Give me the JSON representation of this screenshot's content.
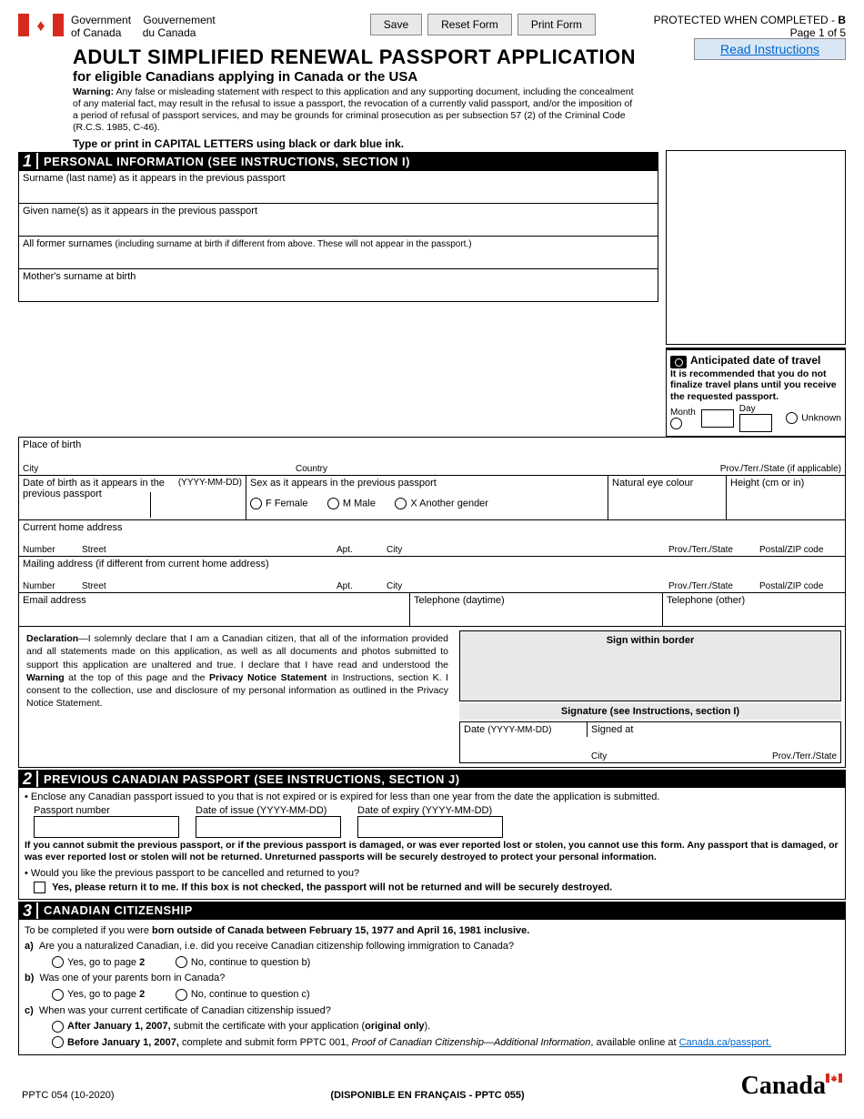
{
  "header": {
    "gov_en": "Government",
    "gov_en2": "of Canada",
    "gov_fr": "Gouvernement",
    "gov_fr2": "du Canada",
    "btn_save": "Save",
    "btn_reset": "Reset Form",
    "btn_print": "Print Form",
    "protected": "PROTECTED WHEN COMPLETED - ",
    "protected_b": "B",
    "page": "Page 1 of 5"
  },
  "title": "ADULT SIMPLIFIED RENEWAL PASSPORT APPLICATION",
  "subtitle": "for eligible Canadians applying in Canada or the USA",
  "warning_label": "Warning:",
  "warning": " Any false or misleading statement with respect to this application and any supporting document, including the concealment of any material fact, may result in the refusal to issue a passport, the revocation of a currently valid passport, and/or the imposition of a period of refusal of passport services, and may be grounds for criminal prosecution as per subsection 57 (2) of the Criminal Code (R.C.S. 1985, C-46).",
  "type_note": "Type or print in CAPITAL LETTERS using black or dark blue ink.",
  "read_instr": "Read Instructions",
  "sec1": {
    "num": "1",
    "title": "PERSONAL INFORMATION (SEE INSTRUCTIONS, SECTION I)",
    "surname": "Surname (last name) as it appears in the previous passport",
    "given": "Given name(s) as it appears in the previous passport",
    "former": "All former surnames ",
    "former_note": "(including surname at birth if different from above. These will not appear in the passport.)",
    "mother": "Mother's surname at birth",
    "pob": "Place of birth",
    "city": "City",
    "country": "Country",
    "prov": "Prov./Terr./State (if applicable)",
    "dob": "Date of birth as it appears in the previous passport",
    "dob_fmt": "(YYYY-MM-DD)",
    "sex": "Sex as it appears in the previous passport",
    "female": "F  Female",
    "male": "M  Male",
    "another": "X  Another gender",
    "eye": "Natural eye colour",
    "height": "Height (cm or in)",
    "home_addr": "Current home address",
    "number": "Number",
    "street": "Street",
    "apt": "Apt.",
    "addr_city": "City",
    "addr_prov": "Prov./Terr./State",
    "postal": "Postal/ZIP code",
    "mail_addr": "Mailing address (if different from current home address)",
    "email": "Email address",
    "tel_day": "Telephone (daytime)",
    "tel_other": "Telephone (other)",
    "decl_label": "Declaration",
    "decl": "—I solemnly declare that I am a Canadian citizen, that all of the information provided and all statements made on this application, as well as all documents and photos submitted to support this application are unaltered and true. I declare that I have read and understood the ",
    "decl_warn": "Warning",
    "decl2": " at the top of this page and the ",
    "decl_priv": "Privacy Notice Statement",
    "decl3": " in Instructions, section K. I consent to the collection, use and disclosure of my personal information as outlined in the Privacy Notice Statement.",
    "sign_within": "Sign within border",
    "sig_label": "Signature (see Instructions, section I)",
    "date": "Date ",
    "date_fmt": "(YYYY-MM-DD)",
    "signed_at": "Signed at",
    "sig_city": "City",
    "sig_prov": "Prov./Terr./State"
  },
  "travel": {
    "title": "Anticipated date of travel",
    "note": "It is recommended that you do not finalize travel plans until you receive the requested passport.",
    "month": "Month",
    "day": "Day",
    "unknown": "Unknown"
  },
  "sec2": {
    "num": "2",
    "title": "PREVIOUS CANADIAN PASSPORT (SEE INSTRUCTIONS, SECTION J)",
    "bullet1": "• Enclose any Canadian passport issued to you that is not expired or is expired for less than one year from the date the application is submitted.",
    "pp_num": "Passport number",
    "doi": "Date of issue (YYYY-MM-DD)",
    "doe": "Date of expiry (YYYY-MM-DD)",
    "cannot": "If you cannot submit the previous passport, or if the previous passport is damaged, or was ever reported lost or stolen, you cannot use this form. Any passport that is damaged, or was ever reported lost or stolen will not be returned. Unreturned passports will be securely destroyed to protect your personal information.",
    "bullet2": "• Would you like the previous passport to be cancelled and returned to you?",
    "yes_return": "Yes, please return it to me. If this box is not checked, the passport will not be returned and will be securely destroyed."
  },
  "sec3": {
    "num": "3",
    "title": "CANADIAN CITIZENSHIP",
    "intro": "To be completed if you were ",
    "intro_bold": "born outside of Canada between February 15, 1977 and April 16, 1981 inclusive.",
    "a": "a)",
    "a_q": "Are you a naturalized Canadian, i.e. did you receive Canadian citizenship following immigration to Canada?",
    "yes_p2": "Yes, go to page ",
    "p2": "2",
    "no_b": "No, continue to question b)",
    "b": "b)",
    "b_q": "Was one of your parents born in Canada?",
    "no_c": "No, continue to question c)",
    "c": "c)",
    "c_q": "When was your current certificate of Canadian citizenship issued?",
    "after": "After January 1, 2007,",
    "after2": " submit the certificate with your application (",
    "orig": "original only",
    "after3": ").",
    "before": "Before January 1, 2007,",
    "before2": " complete and submit form PPTC 001, ",
    "before_it": "Proof of Canadian Citizenship—Additional Information",
    "before3": ", available online at ",
    "link": "Canada.ca/passport."
  },
  "footer": {
    "form_no": "PPTC 054 (10-2020)",
    "fr": "(DISPONIBLE EN FRANÇAIS - PPTC 055)",
    "wordmark": "Canada"
  }
}
